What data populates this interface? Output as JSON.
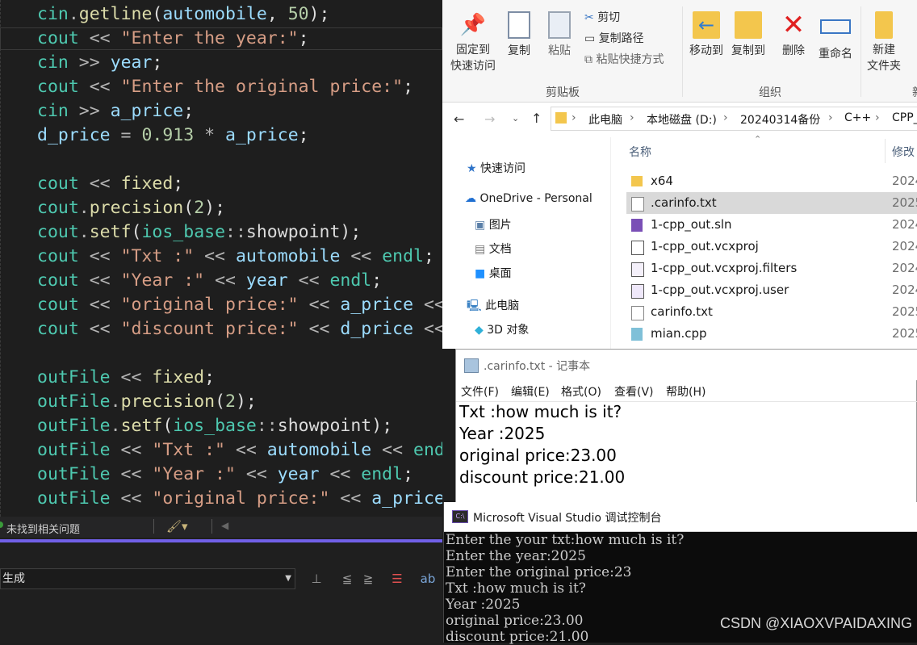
{
  "editor": {
    "lines": [
      [
        [
          "cin",
          "kw"
        ],
        [
          ".",
          "op"
        ],
        [
          "getline",
          "fn"
        ],
        [
          "(",
          "plain"
        ],
        [
          "automobile",
          "var"
        ],
        [
          ", ",
          "plain"
        ],
        [
          "50",
          "num"
        ],
        [
          ");",
          "plain"
        ]
      ],
      [
        [
          "cout",
          "kw"
        ],
        [
          " << ",
          "op"
        ],
        [
          "\"Enter the year:\"",
          "str"
        ],
        [
          ";",
          "plain"
        ]
      ],
      [
        [
          "cin",
          "kw"
        ],
        [
          " >> ",
          "op"
        ],
        [
          "year",
          "var"
        ],
        [
          ";",
          "plain"
        ]
      ],
      [
        [
          "cout",
          "kw"
        ],
        [
          " << ",
          "op"
        ],
        [
          "\"Enter the original price:\"",
          "str"
        ],
        [
          ";",
          "plain"
        ]
      ],
      [
        [
          "cin",
          "kw"
        ],
        [
          " >> ",
          "op"
        ],
        [
          "a_price",
          "var"
        ],
        [
          ";",
          "plain"
        ]
      ],
      [
        [
          "d_price",
          "var"
        ],
        [
          " = ",
          "op"
        ],
        [
          "0.913",
          "num"
        ],
        [
          " * ",
          "op"
        ],
        [
          "a_price",
          "var"
        ],
        [
          ";",
          "plain"
        ]
      ],
      [],
      [
        [
          "cout",
          "kw"
        ],
        [
          " << ",
          "op"
        ],
        [
          "fixed",
          "fn"
        ],
        [
          ";",
          "plain"
        ]
      ],
      [
        [
          "cout",
          "kw"
        ],
        [
          ".",
          "op"
        ],
        [
          "precision",
          "fn"
        ],
        [
          "(",
          "plain"
        ],
        [
          "2",
          "num"
        ],
        [
          ");",
          "plain"
        ]
      ],
      [
        [
          "cout",
          "kw"
        ],
        [
          ".",
          "op"
        ],
        [
          "setf",
          "fn"
        ],
        [
          "(",
          "plain"
        ],
        [
          "ios_base",
          "kw"
        ],
        [
          "::",
          "op"
        ],
        [
          "showpoint",
          "plain"
        ],
        [
          ");",
          "plain"
        ]
      ],
      [
        [
          "cout",
          "kw"
        ],
        [
          " << ",
          "op"
        ],
        [
          "\"Txt :\"",
          "str"
        ],
        [
          " << ",
          "op"
        ],
        [
          "automobile",
          "var"
        ],
        [
          " << ",
          "op"
        ],
        [
          "endl",
          "kw"
        ],
        [
          ";",
          "plain"
        ]
      ],
      [
        [
          "cout",
          "kw"
        ],
        [
          " << ",
          "op"
        ],
        [
          "\"Year :\"",
          "str"
        ],
        [
          " << ",
          "op"
        ],
        [
          "year",
          "var"
        ],
        [
          " << ",
          "op"
        ],
        [
          "endl",
          "kw"
        ],
        [
          ";",
          "plain"
        ]
      ],
      [
        [
          "cout",
          "kw"
        ],
        [
          " << ",
          "op"
        ],
        [
          "\"original price:\"",
          "str"
        ],
        [
          " << ",
          "op"
        ],
        [
          "a_price",
          "var"
        ],
        [
          " <<",
          "op"
        ]
      ],
      [
        [
          "cout",
          "kw"
        ],
        [
          " << ",
          "op"
        ],
        [
          "\"discount price:\"",
          "str"
        ],
        [
          " << ",
          "op"
        ],
        [
          "d_price",
          "var"
        ],
        [
          " <<",
          "op"
        ]
      ],
      [],
      [
        [
          "outFile",
          "kw"
        ],
        [
          " << ",
          "op"
        ],
        [
          "fixed",
          "fn"
        ],
        [
          ";",
          "plain"
        ]
      ],
      [
        [
          "outFile",
          "kw"
        ],
        [
          ".",
          "op"
        ],
        [
          "precision",
          "fn"
        ],
        [
          "(",
          "plain"
        ],
        [
          "2",
          "num"
        ],
        [
          ");",
          "plain"
        ]
      ],
      [
        [
          "outFile",
          "kw"
        ],
        [
          ".",
          "op"
        ],
        [
          "setf",
          "fn"
        ],
        [
          "(",
          "plain"
        ],
        [
          "ios_base",
          "kw"
        ],
        [
          "::",
          "op"
        ],
        [
          "showpoint",
          "plain"
        ],
        [
          ");",
          "plain"
        ]
      ],
      [
        [
          "outFile",
          "kw"
        ],
        [
          " << ",
          "op"
        ],
        [
          "\"Txt :\"",
          "str"
        ],
        [
          " << ",
          "op"
        ],
        [
          "automobile",
          "var"
        ],
        [
          " << ",
          "op"
        ],
        [
          "endl",
          "kw"
        ]
      ],
      [
        [
          "outFile",
          "kw"
        ],
        [
          " << ",
          "op"
        ],
        [
          "\"Year :\"",
          "str"
        ],
        [
          " << ",
          "op"
        ],
        [
          "year",
          "var"
        ],
        [
          " << ",
          "op"
        ],
        [
          "endl",
          "kw"
        ],
        [
          ";",
          "plain"
        ]
      ],
      [
        [
          "outFile",
          "kw"
        ],
        [
          " << ",
          "op"
        ],
        [
          "\"original price:\"",
          "str"
        ],
        [
          " << ",
          "op"
        ],
        [
          "a_price",
          "var"
        ]
      ]
    ]
  },
  "status": {
    "issues": "未找到相关问题"
  },
  "output": {
    "source": "生成"
  },
  "ribbon": {
    "pin": "固定到\n快速访问",
    "copy": "复制",
    "paste": "粘贴",
    "cut": "剪切",
    "copy_path": "复制路径",
    "paste_shortcut": "粘贴快捷方式",
    "move_to": "移动到",
    "copy_to": "复制到",
    "delete": "删除",
    "rename": "重命名",
    "new_folder": "新建\n文件夹",
    "group_clipboard": "剪贴板",
    "group_organize": "组织",
    "group_new": "新"
  },
  "address": [
    "此电脑",
    "本地磁盘 (D:)",
    "20240314备份",
    "C++",
    "CPP_"
  ],
  "nav": {
    "quick": "快速访问",
    "onedrive": "OneDrive - Personal",
    "pictures": "图片",
    "docs": "文档",
    "desktop": "桌面",
    "thispc": "此电脑",
    "objects3d": "3D 对象"
  },
  "files": {
    "col_name": "名称",
    "col_modified": "修改",
    "rows": [
      {
        "name": "x64",
        "date": "2024"
      },
      {
        "name": ".carinfo.txt",
        "date": "2025"
      },
      {
        "name": "1-cpp_out.sln",
        "date": "2024"
      },
      {
        "name": "1-cpp_out.vcxproj",
        "date": "2024"
      },
      {
        "name": "1-cpp_out.vcxproj.filters",
        "date": "2024"
      },
      {
        "name": "1-cpp_out.vcxproj.user",
        "date": "2024"
      },
      {
        "name": "carinfo.txt",
        "date": "2025"
      },
      {
        "name": "mian.cpp",
        "date": "2025"
      }
    ]
  },
  "notepad": {
    "title": ".carinfo.txt - 记事本",
    "menus": [
      "文件(F)",
      "编辑(E)",
      "格式(O)",
      "查看(V)",
      "帮助(H)"
    ],
    "lines": [
      "Txt :how much is it?",
      "Year :2025",
      "original price:23.00",
      "discount price:21.00"
    ]
  },
  "console": {
    "title": "Microsoft Visual Studio 调试控制台",
    "lines": [
      "Enter the your txt:how much is it?",
      "Enter the year:2025",
      "Enter the original price:23",
      "Txt :how much is it?",
      "Year :2025",
      "original price:23.00",
      "discount price:21.00"
    ]
  },
  "watermark": "CSDN @XIAOXVPAIDAXING"
}
